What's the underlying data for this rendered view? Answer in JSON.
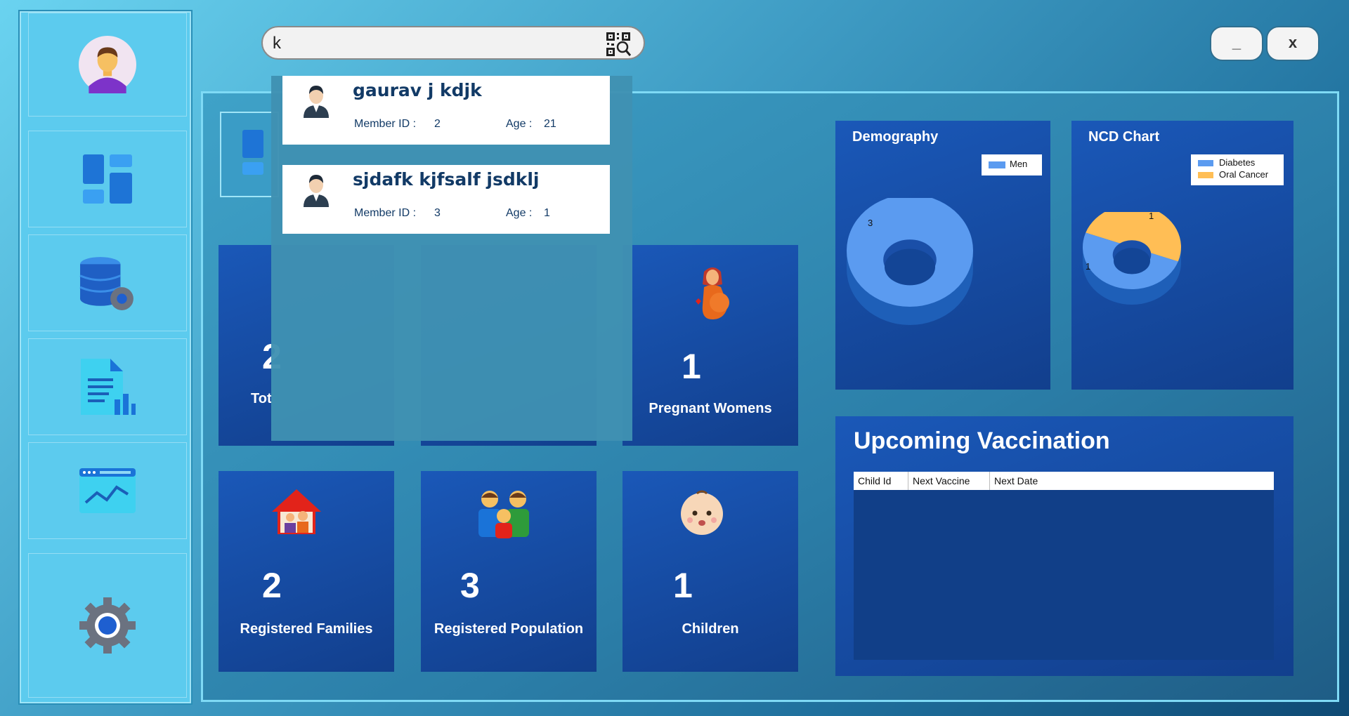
{
  "search": {
    "value": "k",
    "placeholder": ""
  },
  "window_controls": {
    "minimize": "_",
    "close": "x"
  },
  "sidebar": {
    "items": [
      {
        "name": "profile",
        "icon": "user-avatar-icon"
      },
      {
        "name": "dashboard",
        "icon": "dashboard-icon"
      },
      {
        "name": "database",
        "icon": "database-settings-icon"
      },
      {
        "name": "report",
        "icon": "report-document-icon"
      },
      {
        "name": "analytics",
        "icon": "analytics-chart-icon"
      },
      {
        "name": "settings",
        "icon": "settings-gear-icon"
      }
    ]
  },
  "search_results": [
    {
      "name": "gaurav j kdjk",
      "member_id_label": "Member ID :",
      "member_id": "2",
      "age_label": "Age :",
      "age": "21"
    },
    {
      "name": "sjdafk kjfsalf jsdklj",
      "member_id_label": "Member ID :",
      "member_id": "3",
      "age_label": "Age :",
      "age": "1"
    }
  ],
  "tiles": {
    "total": {
      "value": "2",
      "label_partial": "Tot"
    },
    "pregnant": {
      "value": "1",
      "label": "Pregnant Womens"
    },
    "families": {
      "value": "2",
      "label": "Registered Families"
    },
    "population": {
      "value": "3",
      "label": "Registered Population"
    },
    "children": {
      "value": "1",
      "label": "Children"
    }
  },
  "demography": {
    "title": "Demography",
    "legend": [
      "Men"
    ],
    "slice_label": "3"
  },
  "ncd": {
    "title": "NCD Chart",
    "legend": [
      "Diabetes",
      "Oral Cancer"
    ],
    "labels": [
      "1",
      "1"
    ]
  },
  "vaccination": {
    "title": "Upcoming Vaccination",
    "columns": [
      "Child Id",
      "Next Vaccine",
      "Next Date"
    ],
    "rows": []
  },
  "chart_data": [
    {
      "type": "pie",
      "title": "Demography",
      "categories": [
        "Men"
      ],
      "values": [
        3
      ],
      "legend": "top-right"
    },
    {
      "type": "pie",
      "title": "NCD Chart",
      "categories": [
        "Diabetes",
        "Oral Cancer"
      ],
      "values": [
        1,
        1
      ],
      "legend": "top-right"
    }
  ],
  "colors": {
    "tile": "#1a58b8",
    "men": "#5b9bf0",
    "diabetes": "#5b9bf0",
    "oral_cancer": "#ffbe55"
  }
}
